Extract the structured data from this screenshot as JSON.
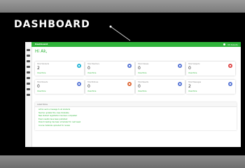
{
  "headline": "DASHBOARD",
  "app": {
    "brand": "Dashboard",
    "user_name": "Mr.Sokoto",
    "greeting": "Hi Ak,",
    "cards": [
      {
        "title": "Total Students",
        "value": "2",
        "link": "View More",
        "accent": "#29b6d8"
      },
      {
        "title": "Total Teachers",
        "value": "0",
        "link": "View More",
        "accent": "#5a78d6"
      },
      {
        "title": "Total Classes",
        "value": "0",
        "link": "View More",
        "accent": "#5a78d6"
      },
      {
        "title": "Total Subjects",
        "value": "0",
        "link": "View More",
        "accent": "#e04a4a"
      },
      {
        "title": "Total Courses",
        "value": "1",
        "link": "View More",
        "accent": "#5a78d6"
      },
      {
        "title": "Total Parents",
        "value": "0",
        "link": "View More",
        "accent": "#5a78d6"
      },
      {
        "title": "Total Notices",
        "value": "0",
        "link": "View More",
        "accent": "#e06b3a"
      },
      {
        "title": "Total Results",
        "value": "0",
        "link": "View More",
        "accent": "#5a78d6"
      },
      {
        "title": "Total Messages",
        "value": "2",
        "link": "View More",
        "accent": "#5a78d6"
      }
    ],
    "notes_title": "Latest Notes",
    "notes": [
      "Admin sent a message to all students",
      "Teacher updated the class timetable",
      "New student registration has been completed",
      "Exam results have been published",
      "Parent meeting has been scheduled for next week",
      "Course materials uploaded for review"
    ]
  },
  "colors": {
    "brand_green": "#2fb43a"
  }
}
